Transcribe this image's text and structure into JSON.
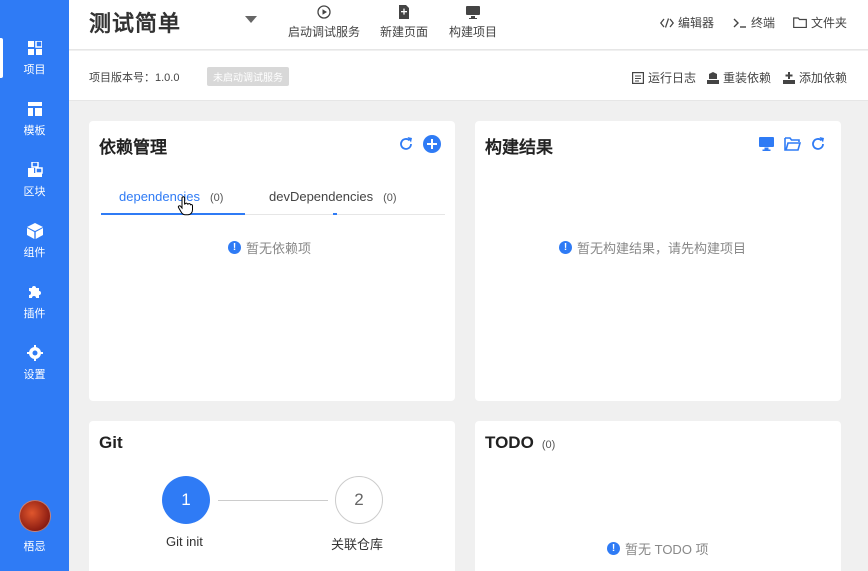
{
  "sidebar": {
    "items": [
      {
        "label": "项目",
        "icon": "project-icon"
      },
      {
        "label": "模板",
        "icon": "template-icon"
      },
      {
        "label": "区块",
        "icon": "block-icon"
      },
      {
        "label": "组件",
        "icon": "component-icon"
      },
      {
        "label": "插件",
        "icon": "plugin-icon"
      },
      {
        "label": "设置",
        "icon": "settings-icon"
      }
    ],
    "user": {
      "name": "梧忌"
    }
  },
  "header": {
    "title": "测试简单",
    "actions": [
      {
        "label": "启动调试服务",
        "icon": "play-icon"
      },
      {
        "label": "新建页面",
        "icon": "new-page-icon"
      },
      {
        "label": "构建项目",
        "icon": "build-icon"
      }
    ],
    "right_actions": [
      {
        "label": "编辑器",
        "icon": "code-icon"
      },
      {
        "label": "终端",
        "icon": "terminal-icon"
      },
      {
        "label": "文件夹",
        "icon": "folder-icon"
      }
    ]
  },
  "subbar": {
    "version": "项目版本号：1.0.0",
    "status": "未启动调试服务",
    "actions": [
      {
        "label": "运行日志",
        "icon": "log-icon"
      },
      {
        "label": "重装依赖",
        "icon": "reinstall-icon"
      },
      {
        "label": "添加依赖",
        "icon": "add-dependency-icon"
      }
    ]
  },
  "deps": {
    "title": "依赖管理",
    "tabs": [
      {
        "label": "dependencies",
        "count": "(0)"
      },
      {
        "label": "devDependencies",
        "count": "(0)"
      }
    ],
    "empty": "暂无依赖项"
  },
  "build": {
    "title": "构建结果",
    "empty": "暂无构建结果，请先构建项目"
  },
  "git": {
    "title": "Git",
    "steps": [
      {
        "num": "1",
        "label": "Git init"
      },
      {
        "num": "2",
        "label": "关联仓库"
      }
    ]
  },
  "todo": {
    "title": "TODO",
    "count": "(0)",
    "empty": "暂无 TODO 项"
  },
  "colors": {
    "primary": "#2f7bf5",
    "background": "#f0f0f0"
  }
}
